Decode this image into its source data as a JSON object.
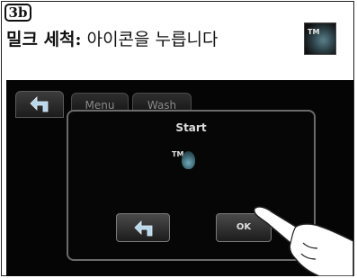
{
  "step": {
    "badge": "3b"
  },
  "instruction": {
    "bold_part": "밀크 세척:",
    "rest": " 아이콘을 누릅니다",
    "icon": "milk-clean-icon",
    "icon_mark": "TM"
  },
  "screen": {
    "back_tab_icon": "back-arrow-icon",
    "tabs": [
      {
        "label": "Menu"
      },
      {
        "label": "Wash"
      }
    ],
    "dialog": {
      "title": "Start",
      "icon": "milk-clean-icon",
      "icon_mark": "TM",
      "back_button_icon": "back-arrow-icon",
      "ok_label": "OK"
    },
    "pointer": "pointing-hand-icon"
  },
  "colors": {
    "screen_bg": "#050505",
    "dialog_border": "#6b6b6b",
    "text_light": "#dcdcdc"
  }
}
